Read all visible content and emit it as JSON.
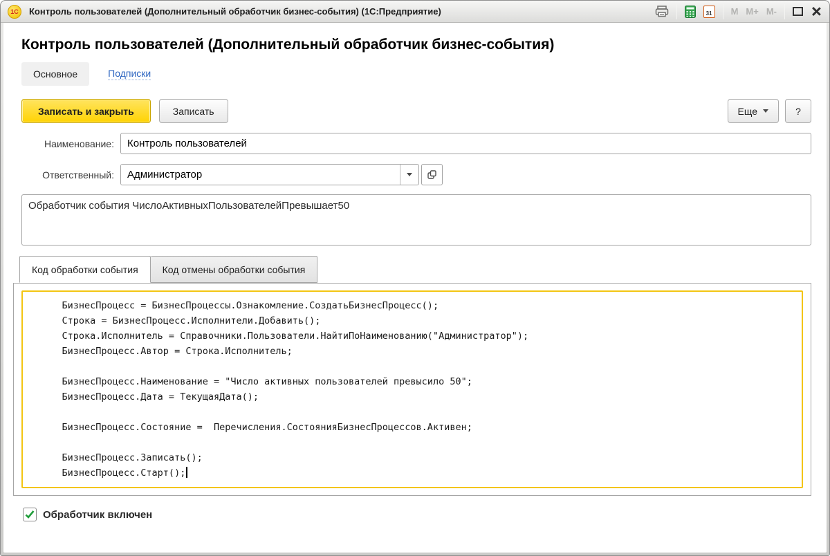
{
  "titlebar": {
    "logo_text": "1С",
    "title": "Контроль пользователей (Дополнительный обработчик бизнес-события)  (1С:Предприятие)",
    "calendar_day": "31",
    "memory_buttons": [
      "M",
      "M+",
      "M-"
    ]
  },
  "page": {
    "title": "Контроль пользователей (Дополнительный обработчик бизнес-события)",
    "nav": {
      "main_label": "Основное",
      "subscriptions_label": "Подписки"
    },
    "toolbar": {
      "save_close_label": "Записать и закрыть",
      "save_label": "Записать",
      "more_label": "Еще",
      "help_label": "?"
    },
    "form": {
      "name_label": "Наименование:",
      "name_value": "Контроль пользователей",
      "responsible_label": "Ответственный:",
      "responsible_value": "Администратор",
      "description_value": "Обработчик события ЧислоАктивныхПользователейПревышает50"
    },
    "code_section": {
      "tabs": [
        {
          "label": "Код обработки события",
          "active": true
        },
        {
          "label": "Код отмены обработки события",
          "active": false
        }
      ],
      "code_lines": [
        "    БизнесПроцесс = БизнесПроцессы.Ознакомление.СоздатьБизнесПроцесс();",
        "    Строка = БизнесПроцесс.Исполнители.Добавить();",
        "    Строка.Исполнитель = Справочники.Пользователи.НайтиПоНаименованию(\"Администратор\");",
        "    БизнесПроцесс.Автор = Строка.Исполнитель;",
        "",
        "    БизнесПроцесс.Наименование = \"Число активных пользователей превысило 50\";",
        "    БизнесПроцесс.Дата = ТекущаяДата();",
        "",
        "    БизнесПроцесс.Состояние =  Перечисления.СостоянияБизнесПроцессов.Активен;",
        "",
        "    БизнесПроцесс.Записать();",
        "    БизнесПроцесс.Старт();"
      ]
    },
    "footer": {
      "handler_enabled_label": "Обработчик включен",
      "handler_enabled_checked": true
    }
  },
  "colors": {
    "accent_yellow": "#ffd303",
    "focus_border": "#f3c512",
    "link_blue": "#2e66c1",
    "logo_red": "#d42a1e",
    "check_green": "#1f9d3a"
  }
}
